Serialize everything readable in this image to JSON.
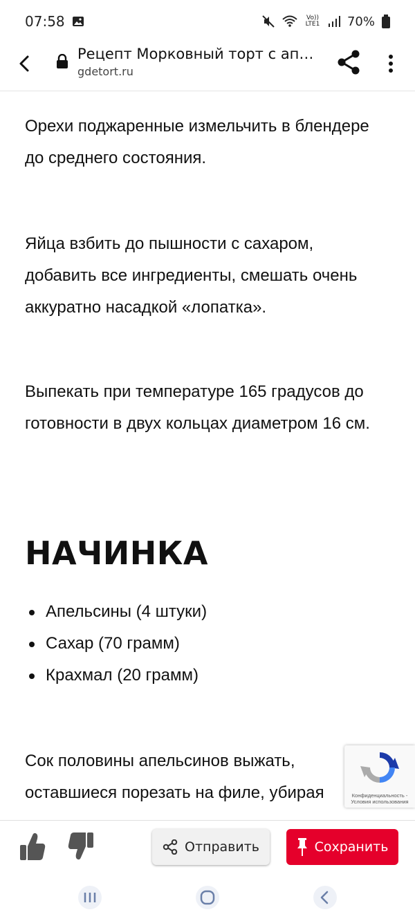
{
  "status_bar": {
    "time": "07:58",
    "battery": "70%",
    "icons": [
      "gallery-icon",
      "mute-icon",
      "wifi-icon",
      "volte-icon",
      "signal-icon",
      "battery-icon"
    ],
    "volte_label": "Vo)) LTE1"
  },
  "header": {
    "title": "Рецепт Морковный торт с апел...",
    "url": "gdetort.ru",
    "icons": [
      "back-arrow-icon",
      "lock-icon",
      "share-icon",
      "more-vertical-icon"
    ]
  },
  "article": {
    "paragraph1": "Орехи поджаренные измельчить в блендере до среднего состояния.",
    "paragraph2": "Яйца взбить до пышности с сахаром, добавить все ингредиенты, смешать очень аккуратно насадкой «лопатка».",
    "paragraph3": "Выпекать при температуре 165 градусов до готовности в двух кольцах диаметром 16 см.",
    "heading": "НАЧИНКА",
    "ingredients": [
      "Апельсины (4 штуки)",
      "Сахар (70 грамм)",
      "Крахмал (20 грамм)"
    ],
    "paragraph4_line1": "Сок половины апельсинов выжать,",
    "paragraph4_line2": "оставшиеся порезать на филе, убирая"
  },
  "recaptcha": {
    "text": "Конфиденциальность - Условия использования"
  },
  "action_bar": {
    "send_label": "Отправить",
    "save_label": "Сохранить",
    "accent_color": "#e5002b",
    "icons": [
      "thumbs-up-icon",
      "thumbs-down-icon",
      "share-icon",
      "pin-icon"
    ]
  },
  "nav_bar": {
    "icons": [
      "recents-icon",
      "home-icon",
      "back-icon"
    ]
  }
}
